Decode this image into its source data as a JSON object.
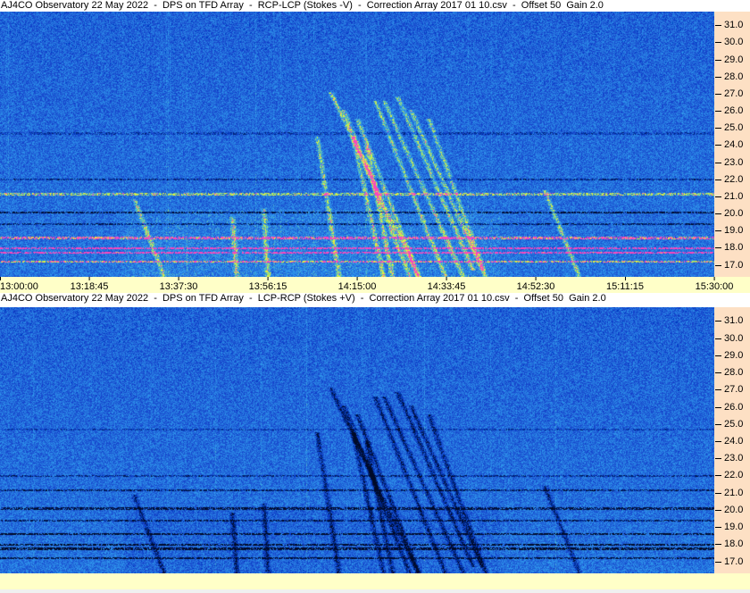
{
  "panels": [
    {
      "title": "AJ4CO Observatory 22 May 2022  -  DPS on TFD Array  -  RCP-LCP (Stokes -V)  -  Correction Array 2017 01 10.csv  -  Offset 50  Gain 2.0",
      "polarity": "RCP-LCP",
      "burst_color": "bright"
    },
    {
      "title": "AJ4CO Observatory 22 May 2022  -  DPS on TFD Array  -  LCP-RCP (Stokes +V)  -  Correction Array 2017 01 10.csv  -  Offset 50  Gain 2.0",
      "polarity": "LCP-RCP",
      "burst_color": "dark"
    }
  ],
  "chart_data": {
    "type": "heatmap",
    "x_ticks": [
      "13:00:00",
      "13:18:45",
      "13:37:30",
      "13:56:15",
      "14:15:00",
      "14:33:45",
      "14:52:30",
      "15:11:15",
      "15:30:00"
    ],
    "x_range": [
      "13:00:00",
      "15:30:00"
    ],
    "y_ticks": [
      "31.0",
      "30.0",
      "29.0",
      "28.0",
      "27.0",
      "26.0",
      "25.0",
      "24.0",
      "23.0",
      "22.0",
      "21.0",
      "20.0",
      "19.0",
      "18.0",
      "17.0"
    ],
    "y_range": [
      16.3,
      31.8
    ],
    "y_axis_side": "right",
    "colormap": [
      "#000020",
      "#1040d0",
      "#2a6ef0",
      "#30c0f0",
      "#a0f060",
      "#f0f040",
      "#ff40c0"
    ],
    "background_color": "#1e5adc",
    "axis_color": "#fde0c4",
    "time_axis_color": "#ffffc8"
  }
}
